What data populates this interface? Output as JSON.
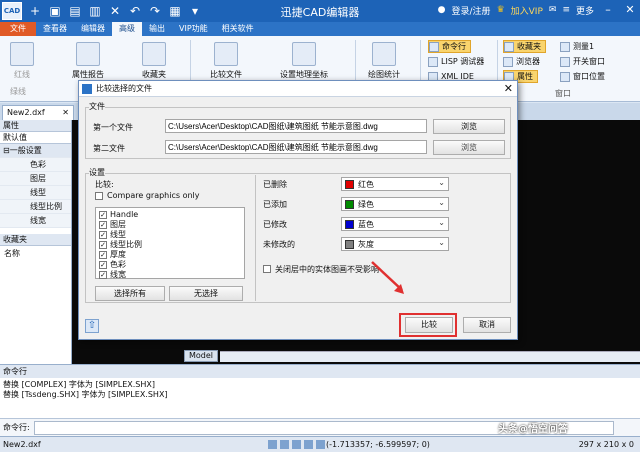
{
  "titlebar": {
    "logo": "CAD",
    "title": "迅捷CAD编辑器",
    "login": "登录/注册",
    "vip": "加入VIP",
    "more": "更多"
  },
  "menu": [
    "文件",
    "查看器",
    "编辑器",
    "高级",
    "输出",
    "VIP功能",
    "相关软件"
  ],
  "ribbon": {
    "red_line": "红线",
    "property_report": "属性报告",
    "favorites": "收藏夹",
    "green_line": "绿线",
    "compare_files": "比较文件",
    "set_geo_coords": "设置地理坐标",
    "drawing_stats": "绘图统计",
    "command_line": "命令行",
    "lisp_debugger": "LISP 调试器",
    "xml_ide": "XML IDE",
    "favorites_small": "收藏夹",
    "browser": "浏览器",
    "properties": "属性",
    "measure1": "测量1",
    "open_window": "开关窗口",
    "window_position": "窗口位置",
    "window_group": "窗口"
  },
  "doc_tab": "New2.dxf",
  "left_panel": {
    "header": "属性",
    "defaults": "默认值",
    "group": "一般设置",
    "rows": [
      "色彩",
      "图层",
      "线型",
      "线型比例",
      "线宽"
    ],
    "favorites_header": "收藏夹",
    "name_label": "名称"
  },
  "model_tab": "Model",
  "command": {
    "header": "命令行",
    "lines": [
      "替换 [COMPLEX] 字体为 [SIMPLEX.SHX]",
      "替换 [Tssdeng.SHX] 字体为 [SIMPLEX.SHX]"
    ],
    "prompt": "命令行:"
  },
  "status": {
    "file": "New2.dxf",
    "coords": "(-1.713357; -6.599597; 0)",
    "size": "297 x 210 x 0"
  },
  "dialog": {
    "title": "比较选择的文件",
    "files_legend": "文件",
    "first_file_label": "第一个文件",
    "first_file_value": "C:\\Users\\Acer\\Desktop\\CAD图纸\\建筑图纸 节能示意图.dwg",
    "second_file_label": "第二文件",
    "second_file_value": "C:\\Users\\Acer\\Desktop\\CAD图纸\\建筑图纸 节能示意图.dwg",
    "browse": "浏览",
    "settings_legend": "设置",
    "compare_label": "比较:",
    "compare_graphics_only": "Compare graphics only",
    "properties": [
      "Handle",
      "图层",
      "线型",
      "线型比例",
      "厚度",
      "色彩",
      "线宽"
    ],
    "select_all": "选择所有",
    "select_none": "无选择",
    "deleted_label": "已删除",
    "deleted_color": "红色",
    "added_label": "已添加",
    "added_color": "绿色",
    "modified_label": "已修改",
    "modified_color": "蓝色",
    "unmodified_label": "未修改的",
    "unmodified_color": "灰度",
    "closed_layer_option": "关闭层中的实体图画不受影响",
    "compare_button": "比较",
    "cancel_button": "取消",
    "colors": {
      "red": "#e00000",
      "green": "#008a00",
      "blue": "#0000d0",
      "gray": "#808080"
    }
  },
  "watermark": "头条@悟空问答",
  "colors": {
    "titlebar": "#1d63b7",
    "file_tab": "#e05a26",
    "highlight": "#e03030"
  }
}
